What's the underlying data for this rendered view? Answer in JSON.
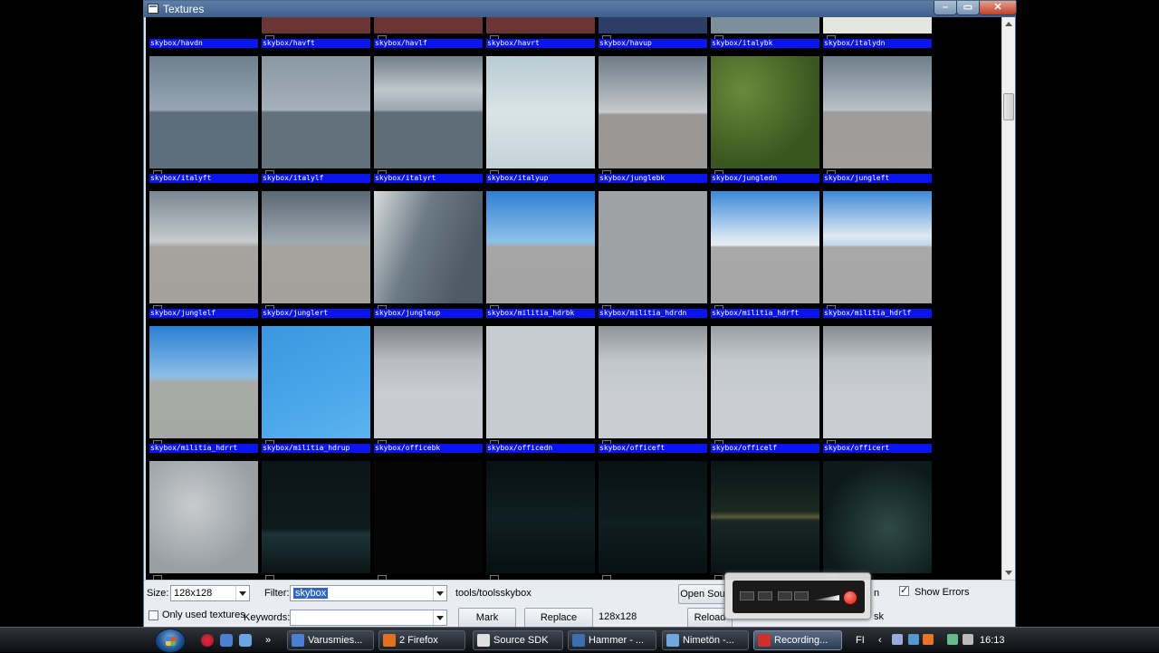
{
  "window": {
    "title": "Textures"
  },
  "tiles": [
    {
      "name": "",
      "bg": "#6b3536"
    },
    {
      "name": "",
      "bg": "#6b3536"
    },
    {
      "name": "",
      "bg": "#6b3536"
    },
    {
      "name": "",
      "bg": "#2d3e66"
    },
    {
      "name": "",
      "bg": "#7e8f9c"
    },
    {
      "name": "",
      "bg": "#e3e5df"
    },
    {
      "name": "skybox/havdn",
      "bg": "linear-gradient(#6d7f8e, #97a6b2 48%, #5d6d79 50%, #5e6e7a)"
    },
    {
      "name": "skybox/havft",
      "bg": "linear-gradient(#8a98a4, #a4b0ba 48%, #63717c 50%, #63717c)"
    },
    {
      "name": "skybox/havlf",
      "bg": "linear-gradient(#6f7e89, #c0c8cc 30%, #9aa6ae 48%, #5f6d78 50%, #5f6d78)"
    },
    {
      "name": "skybox/havrt",
      "bg": "linear-gradient(#b9cbd2, #d9e4e7 50%, #c4d3d8)"
    },
    {
      "name": "skybox/havup",
      "bg": "linear-gradient(#6e7b86, #c5cbce 50%, #9a9897 52%, #9a9897)"
    },
    {
      "name": "skybox/italybk",
      "bg": "radial-gradient(circle at 30% 30%, #6a8a3a, #3a5520 70%)"
    },
    {
      "name": "skybox/italydn",
      "bg": "linear-gradient(#6e7d8a, #b8c1c6 48%, #9e9c9a 50%, #a09e9c)"
    },
    {
      "name": "skybox/italyft",
      "bg": "linear-gradient(#7a8791, #c6ccce 45%, #a6a29e 50%, #a4a09c)"
    },
    {
      "name": "skybox/italylf",
      "bg": "linear-gradient(#5a6875, #9eaab2 45%, #a6a29e 50%, #a4a09c)"
    },
    {
      "name": "skybox/italyrt",
      "bg": "linear-gradient(110deg, #d6dbdc, #6d7b86 40%, #4e5a65 80%)"
    },
    {
      "name": "skybox/italyup",
      "bg": "linear-gradient(#2f7fd0, #8fc1ea 45%, #a6a6a6 50%, #a3a3a3)"
    },
    {
      "name": "skybox/junglebk",
      "bg": "#9ea2a4"
    },
    {
      "name": "skybox/jungledn",
      "bg": "linear-gradient(#3a88d8, #cfe2f2 40%, #e9eef1 48%, #a8a8a8 50%, #a6a6a6)"
    },
    {
      "name": "skybox/jungleft",
      "bg": "linear-gradient(#3d8ad8, #dfe9f0 40%, #bfd6ea 48%, #a8a8a8 50%, #a6a6a6)"
    },
    {
      "name": "skybox/junglelf",
      "bg": "linear-gradient(#2a7fd2, #8cbfe8 45%, #a8aaa8 50%, #a6a8a6)"
    },
    {
      "name": "skybox/junglert",
      "bg": "linear-gradient(155deg, #3a97e0, #4aa7ea 60%, #5db3ee)"
    },
    {
      "name": "skybox/jungleup",
      "bg": "linear-gradient(#7d8186, #b8bcc0 30%, #c9cdd1 60%, #c7cbcf)"
    },
    {
      "name": "skybox/militia_hdrbk",
      "bg": "#c7ccd0"
    },
    {
      "name": "skybox/militia_hdrdn",
      "bg": "linear-gradient(#8e9398, #c1c6ca 30%, #c9cdd1 60%)"
    },
    {
      "name": "skybox/militia_hdrft",
      "bg": "linear-gradient(#9a9fa4, #c3c8cc 30%, #c9cdd1 60%)"
    },
    {
      "name": "skybox/militia_hdrlf",
      "bg": "linear-gradient(#868b90, #bfc4c8 30%, #c9cdd1 60%)"
    },
    {
      "name": "skybox/militia_hdrrt",
      "bg": "radial-gradient(circle at 40% 40%, #c8cccf, #9a9fa3 70%)"
    },
    {
      "name": "skybox/militia_hdrup",
      "bg": "linear-gradient(#0c1518, #0e1a1d 60%, #1d3336 65%, #0c1518)"
    },
    {
      "name": "skybox/officebk",
      "bg": "#050505"
    },
    {
      "name": "skybox/officedn",
      "bg": "linear-gradient(#071013, #0f1f22 50%, #071013)"
    },
    {
      "name": "skybox/officeft",
      "bg": "linear-gradient(#081114, #0f1e21 55%, #081114)"
    },
    {
      "name": "skybox/officelf",
      "bg": "linear-gradient(#0a1416, #1a2a22 45%, #5b5a3a 50%, #182624 53%, #0a1416)"
    },
    {
      "name": "skybox/officert",
      "bg": "radial-gradient(circle at 60% 60%, #2f4a46, #0d1a1c 70%)"
    }
  ],
  "controls": {
    "size_label": "Size:",
    "size_value": "128x128",
    "filter_label": "Filter:",
    "filter_value": "skybox",
    "path_text": "tools/toolsskybox",
    "open_source_label": "Open Sou",
    "show_errors_label": "Show Errors",
    "only_used_label": "Only used textures",
    "keywords_label": "Keywords:",
    "keywords_value": "",
    "mark_label": "Mark",
    "replace_label": "Replace",
    "dim_text": "128x128",
    "reload_label": "Reload",
    "partial_n": "n",
    "partial_sk": "sk"
  },
  "taskbar": {
    "items": [
      {
        "label": "Varusmies...",
        "icon_color": "#4a7fd1"
      },
      {
        "label": "2 Firefox",
        "icon_color": "#e2701f"
      },
      {
        "label": "Source SDK",
        "icon_color": "#e0e0e0"
      },
      {
        "label": "Hammer - ...",
        "icon_color": "#3b6fb0"
      },
      {
        "label": "Nimetön -...",
        "icon_color": "#6fa8dc"
      },
      {
        "label": "Recording...",
        "icon_color": "#d0302a"
      }
    ],
    "lang": "FI",
    "clock": "16:13"
  },
  "colors": {
    "label_blue": "#0a14f0",
    "selection": "#3065c6"
  }
}
